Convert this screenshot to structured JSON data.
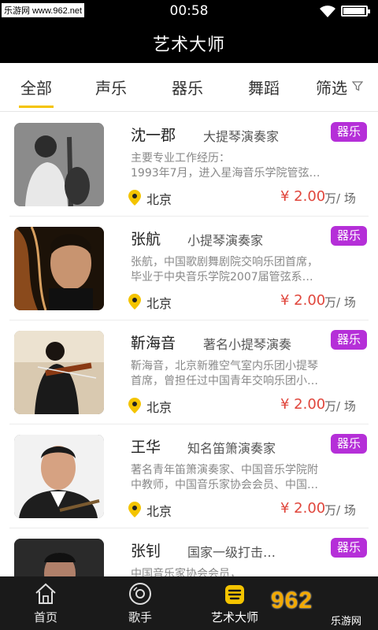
{
  "status_bar": {
    "time": "00:58",
    "watermark": "乐游网 www.962.net"
  },
  "header": {
    "title": "艺术大师"
  },
  "tabs": [
    {
      "label": "全部",
      "active": true
    },
    {
      "label": "声乐",
      "active": false
    },
    {
      "label": "器乐",
      "active": false
    },
    {
      "label": "舞蹈",
      "active": false
    },
    {
      "label": "筛选",
      "active": false
    }
  ],
  "artists": [
    {
      "name": "沈一郡",
      "role": "大提琴演奏家",
      "tag": "器乐",
      "desc": "主要专业工作经历：\n1993年7月，进入星海音乐学院管弦…",
      "city": "北京",
      "price": "¥ 2.00",
      "unit": "万/ 场"
    },
    {
      "name": "张航",
      "role": "小提琴演奏家",
      "tag": "器乐",
      "desc": "张航，中国歌剧舞剧院交响乐团首席，\n毕业于中央音乐学院2007届管弦系…",
      "city": "北京",
      "price": "¥ 2.00",
      "unit": "万/ 场"
    },
    {
      "name": "靳海音",
      "role": "著名小提琴演奏",
      "tag": "器乐",
      "desc": "靳海音，北京新雅空气室内乐团小提琴\n首席，曾担任过中国青年交响乐团小…",
      "city": "北京",
      "price": "¥ 2.00",
      "unit": "万/ 场"
    },
    {
      "name": "王华",
      "role": "知名笛箫演奏家",
      "tag": "器乐",
      "desc": "著名青年笛箫演奏家、中国音乐学院附\n中教师，中国音乐家协会会员、中国…",
      "city": "北京",
      "price": "¥ 2.00",
      "unit": "万/ 场"
    },
    {
      "name": "张钊",
      "role": "国家一级打击…",
      "tag": "器乐",
      "desc": "中国音乐家协会会员，",
      "city": "",
      "price": "",
      "unit": ""
    }
  ],
  "bottom_nav": [
    {
      "label": "首页",
      "icon": "home-icon",
      "active": false
    },
    {
      "label": "歌手",
      "icon": "disc-icon",
      "active": false
    },
    {
      "label": "艺术大师",
      "icon": "master-icon",
      "active": true
    }
  ],
  "brand_watermark": {
    "main": "962",
    "sub": "乐游网"
  },
  "colors": {
    "accent": "#f4c400",
    "tag": "#b52fd8",
    "price": "#e0463c",
    "header_bg": "#000000",
    "bottom_bar_bg": "#1a1a1a"
  }
}
